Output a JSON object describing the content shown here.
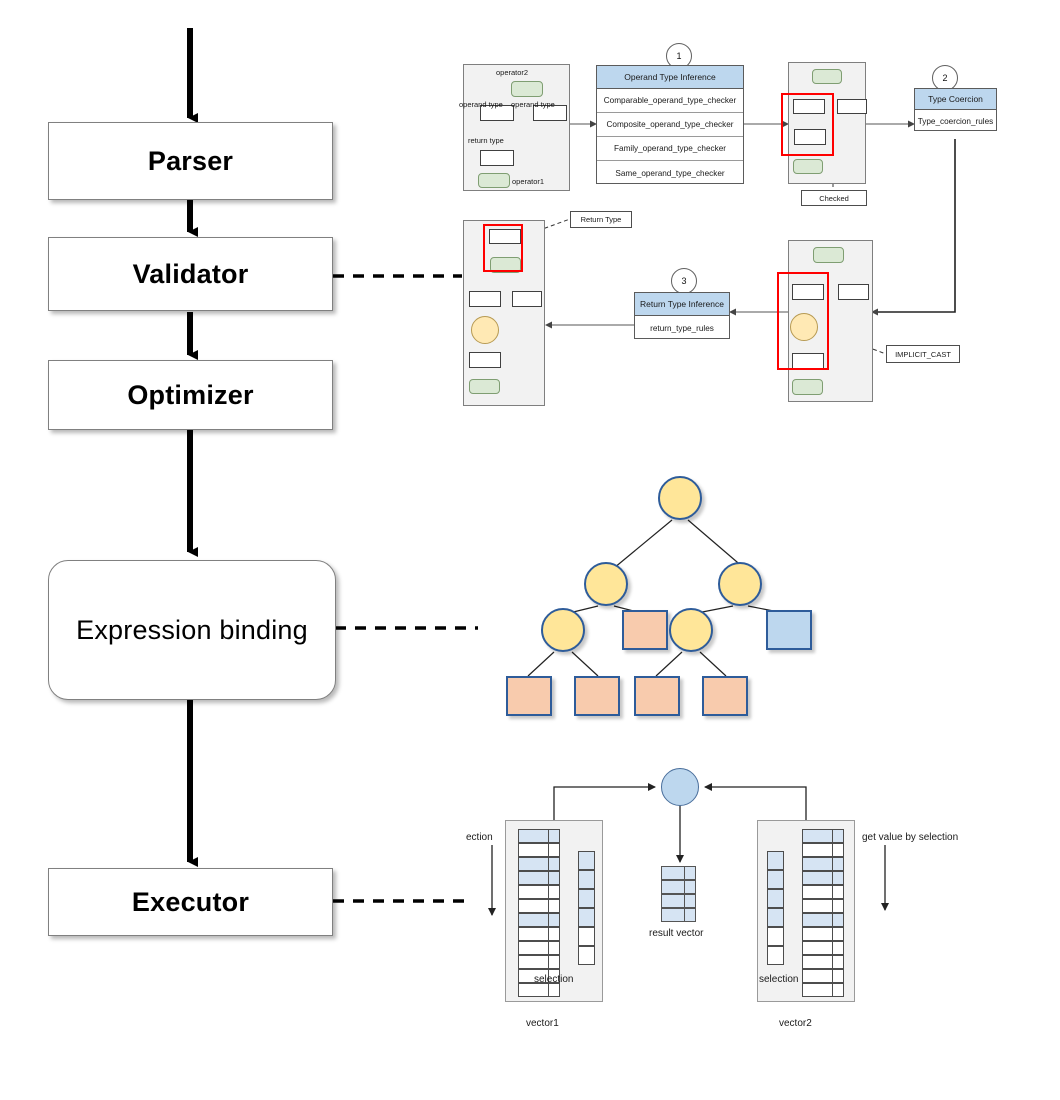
{
  "pipeline": {
    "stages": [
      {
        "id": "parser",
        "label": "Parser"
      },
      {
        "id": "validator",
        "label": "Validator"
      },
      {
        "id": "optimizer",
        "label": "Optimizer"
      },
      {
        "id": "expression-binding",
        "label": "Expression binding"
      },
      {
        "id": "executor",
        "label": "Executor"
      }
    ]
  },
  "validator_detail": {
    "step1": {
      "number": "1",
      "table_title": "Operand Type  Inference",
      "rules": [
        "Comparable_operand_type_checker",
        "Composite_operand_type_checker",
        "Family_operand_type_checker",
        "Same_operand_type_checker"
      ]
    },
    "step2": {
      "number": "2",
      "table_title": "Type Coercion",
      "rules": [
        "Type_coercion_rules"
      ]
    },
    "step3": {
      "number": "3",
      "table_title": "Return Type Inference",
      "rules": [
        "return_type_rules"
      ]
    },
    "ast1_labels": {
      "operator2": "operator2",
      "operand_type_left": "operand type",
      "operand_type_right": "operand type",
      "return_type": "return type",
      "operator1": "operator1"
    },
    "callouts": {
      "checked": "Checked",
      "return_type": "Return Type",
      "implicit_cast": "IMPLICIT_CAST"
    }
  },
  "expression_tree": {
    "nodes": [
      {
        "id": "root",
        "shape": "circle",
        "color": "#FFE699",
        "level": 0
      },
      {
        "id": "l1-left",
        "shape": "circle",
        "color": "#FFE699",
        "level": 1
      },
      {
        "id": "l1-right",
        "shape": "circle",
        "color": "#FFE699",
        "level": 1
      },
      {
        "id": "l2-a",
        "shape": "circle",
        "color": "#FFE699",
        "level": 2
      },
      {
        "id": "l2-b",
        "shape": "square",
        "color": "#F8CBAD",
        "level": 2
      },
      {
        "id": "l2-c",
        "shape": "circle",
        "color": "#FFE699",
        "level": 2
      },
      {
        "id": "l2-d",
        "shape": "square",
        "color": "#BDD7EE",
        "level": 2
      },
      {
        "id": "l3-a",
        "shape": "square",
        "color": "#F8CBAD",
        "level": 3
      },
      {
        "id": "l3-b",
        "shape": "square",
        "color": "#F8CBAD",
        "level": 3
      },
      {
        "id": "l3-c",
        "shape": "square",
        "color": "#F8CBAD",
        "level": 3
      },
      {
        "id": "l3-d",
        "shape": "square",
        "color": "#F8CBAD",
        "level": 3
      }
    ],
    "border_color": "#2E5C9A"
  },
  "executor_detail": {
    "left_arrow_label": "ection",
    "right_arrow_label": "get value by selection",
    "vector1_label": "vector1",
    "vector2_label": "vector2",
    "result_label": "result vector",
    "selection_label_left": "selection",
    "selection_label_right": "selection",
    "operator_glyph": "+",
    "vector1_rows": 12,
    "vector1_filled_rows": [
      0,
      2,
      3,
      6
    ],
    "vector2_rows": 12,
    "vector2_filled_rows": [
      0,
      2,
      3,
      6
    ],
    "selection_cells": 6,
    "selection_filled": [
      0,
      1,
      2,
      3
    ],
    "result_rows": 4,
    "result_filled": [
      0,
      1,
      2,
      3
    ],
    "fill_color": "#D6E4F3"
  }
}
